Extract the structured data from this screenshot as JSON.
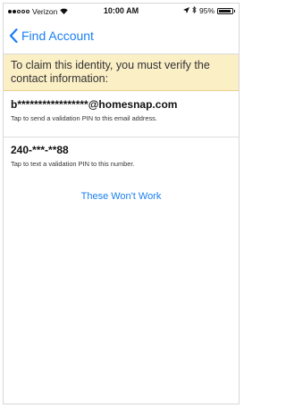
{
  "status_bar": {
    "carrier": "Verizon",
    "time": "10:00 AM",
    "battery_percent": "95%",
    "signal_bars_filled": 2,
    "signal_bars_total": 5,
    "battery_level": 0.95,
    "icons": [
      "wifi-icon",
      "location-arrow-icon",
      "bluetooth-icon",
      "battery-icon"
    ]
  },
  "nav": {
    "back_label": "Find Account",
    "back_icon": "chevron-left-icon",
    "accent_color": "#1a7ff2"
  },
  "banner": {
    "text": "To claim this identity, you must verify the contact information:",
    "background_color": "#fbefc6"
  },
  "options": [
    {
      "value": "b*****************@homesnap.com",
      "description": "Tap to send a validation PIN to this email address."
    },
    {
      "value": "240-***-**88",
      "description": "Tap to text a validation PIN to this number."
    }
  ],
  "actions": {
    "wont_work_label": "These Won't Work"
  }
}
